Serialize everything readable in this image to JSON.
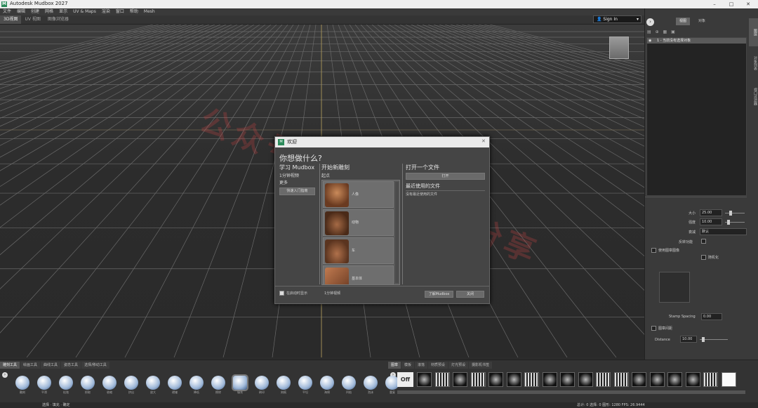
{
  "app": {
    "title": "Autodesk Mudbox 2027"
  },
  "menu": [
    "文件",
    "编辑",
    "创建",
    "网格",
    "显示",
    "UV & Maps",
    "渲染",
    "窗口",
    "帮助",
    "Mesh"
  ],
  "view_tabs": [
    "3D视图",
    "UV 视图",
    "图像浏览器"
  ],
  "signin": "Sign In",
  "right_panel": {
    "tabs": [
      "视图",
      "对象"
    ],
    "side_tabs": [
      "图层",
      "对象列表",
      "视口过滤器"
    ],
    "layer_row": "1 - 当前没有选择对象",
    "props": {
      "size_label": "大小",
      "size_value": "25.00",
      "strength_label": "强度",
      "strength_value": "10.00",
      "falloff_label": "衰减",
      "falloff_value": "默认",
      "mirror_label": "反转功能",
      "use_stamp_label": "使用图章图像",
      "rotate_label": "随机化",
      "stamp_spacing_label": "Stamp Spacing",
      "stamp_spacing_value": "0.00",
      "use_stroke_label": "图章间距",
      "distance_label": "Distance",
      "distance_value": "10.00"
    }
  },
  "dialog": {
    "title": "欢迎",
    "heading": "你想做什么?",
    "learn": {
      "title": "学习 Mudbox",
      "video": "1分钟视频",
      "more": "更多",
      "btn": "快速入门指南"
    },
    "sculpt": {
      "title": "开始新雕刻",
      "subtitle": "起点",
      "items": [
        "人像",
        "动物",
        "车",
        "基本体"
      ]
    },
    "open": {
      "title": "打开一个文件",
      "btn": "打开",
      "recent_title": "最近使用的文件",
      "recent_empty": "没有最近使用的文件"
    },
    "footer": {
      "startup_check": "在启动时显示",
      "one_min": "1分钟视频",
      "learn_btn": "了解Mudbox",
      "close_btn": "关闭"
    }
  },
  "bottom": {
    "tool_tabs": [
      "雕刻工具",
      "绘画工具",
      "曲线工具",
      "姿态工具",
      "选择/移动工具"
    ],
    "tools": [
      "雕刻",
      "平滑",
      "松弛",
      "抓取",
      "收缩",
      "挤出",
      "放大",
      "褶皱",
      "降低",
      "擦除",
      "填充",
      "刷印",
      "刻痕",
      "平坦",
      "海绵",
      "凹陷",
      "泡沫",
      "重复"
    ],
    "stamp_tabs": [
      "图章",
      "模板",
      "滚落",
      "材质预设",
      "灯光预设",
      "摄影机书签"
    ],
    "stamp_off": "Off",
    "status": "选择 · 填充 · 确定",
    "stats": "总计: 0   选择: 0   图形: 1280   FPS: 26.9444"
  },
  "watermark": "公众号 : 独立游戏分享"
}
